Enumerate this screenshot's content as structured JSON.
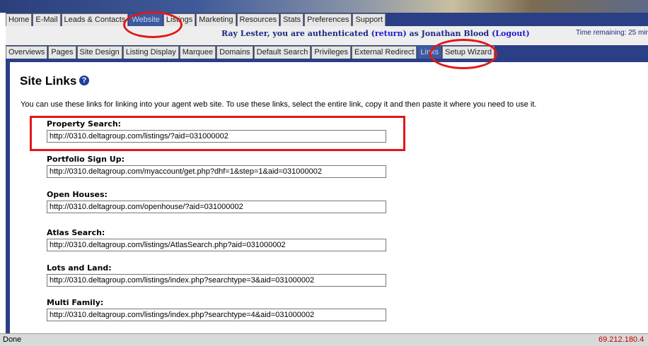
{
  "main_tabs": [
    "Home",
    "E-Mail",
    "Leads & Contacts",
    "Website",
    "Listings",
    "Marketing",
    "Resources",
    "Stats",
    "Preferences",
    "Support"
  ],
  "main_active": "Website",
  "auth": {
    "prefix": "Ray Lester, you are authenticated",
    "return_label": "(return)",
    "middle": "as Jonathan Blood",
    "logout_label": "(Logout)",
    "time_remaining": "Time remaining: 25 mir"
  },
  "sub_tabs": [
    "Overviews",
    "Pages",
    "Site Design",
    "Listing Display",
    "Marquee",
    "Domains",
    "Default Search",
    "Privileges",
    "External Redirect",
    "Links",
    "Setup Wizard"
  ],
  "sub_active": "Links",
  "page": {
    "title": "Site Links",
    "intro": "You can use these links for linking into your agent web site. To use these links, select the entire link, copy it and then paste it where you need to use it."
  },
  "links": [
    {
      "label": "Property Search:",
      "url": "http://0310.deltagroup.com/listings/?aid=031000002"
    },
    {
      "label": "Portfolio Sign Up:",
      "url": "http://0310.deltagroup.com/myaccount/get.php?dhf=1&step=1&aid=031000002"
    },
    {
      "label": "Open Houses:",
      "url": "http://0310.deltagroup.com/openhouse/?aid=031000002"
    },
    {
      "label": "Atlas Search:",
      "url": "http://0310.deltagroup.com/listings/AtlasSearch.php?aid=031000002"
    },
    {
      "label": "Lots and Land:",
      "url": "http://0310.deltagroup.com/listings/index.php?searchtype=3&aid=031000002"
    },
    {
      "label": "Multi Family:",
      "url": "http://0310.deltagroup.com/listings/index.php?searchtype=4&aid=031000002"
    }
  ],
  "status": {
    "left": "Done",
    "right": "69.212.180.4"
  },
  "colors": {
    "frame": "#2a3f85",
    "active_tab": "#3d5aa0",
    "annotation": "#e01818"
  },
  "icons": {
    "help": "question-circle-icon"
  }
}
